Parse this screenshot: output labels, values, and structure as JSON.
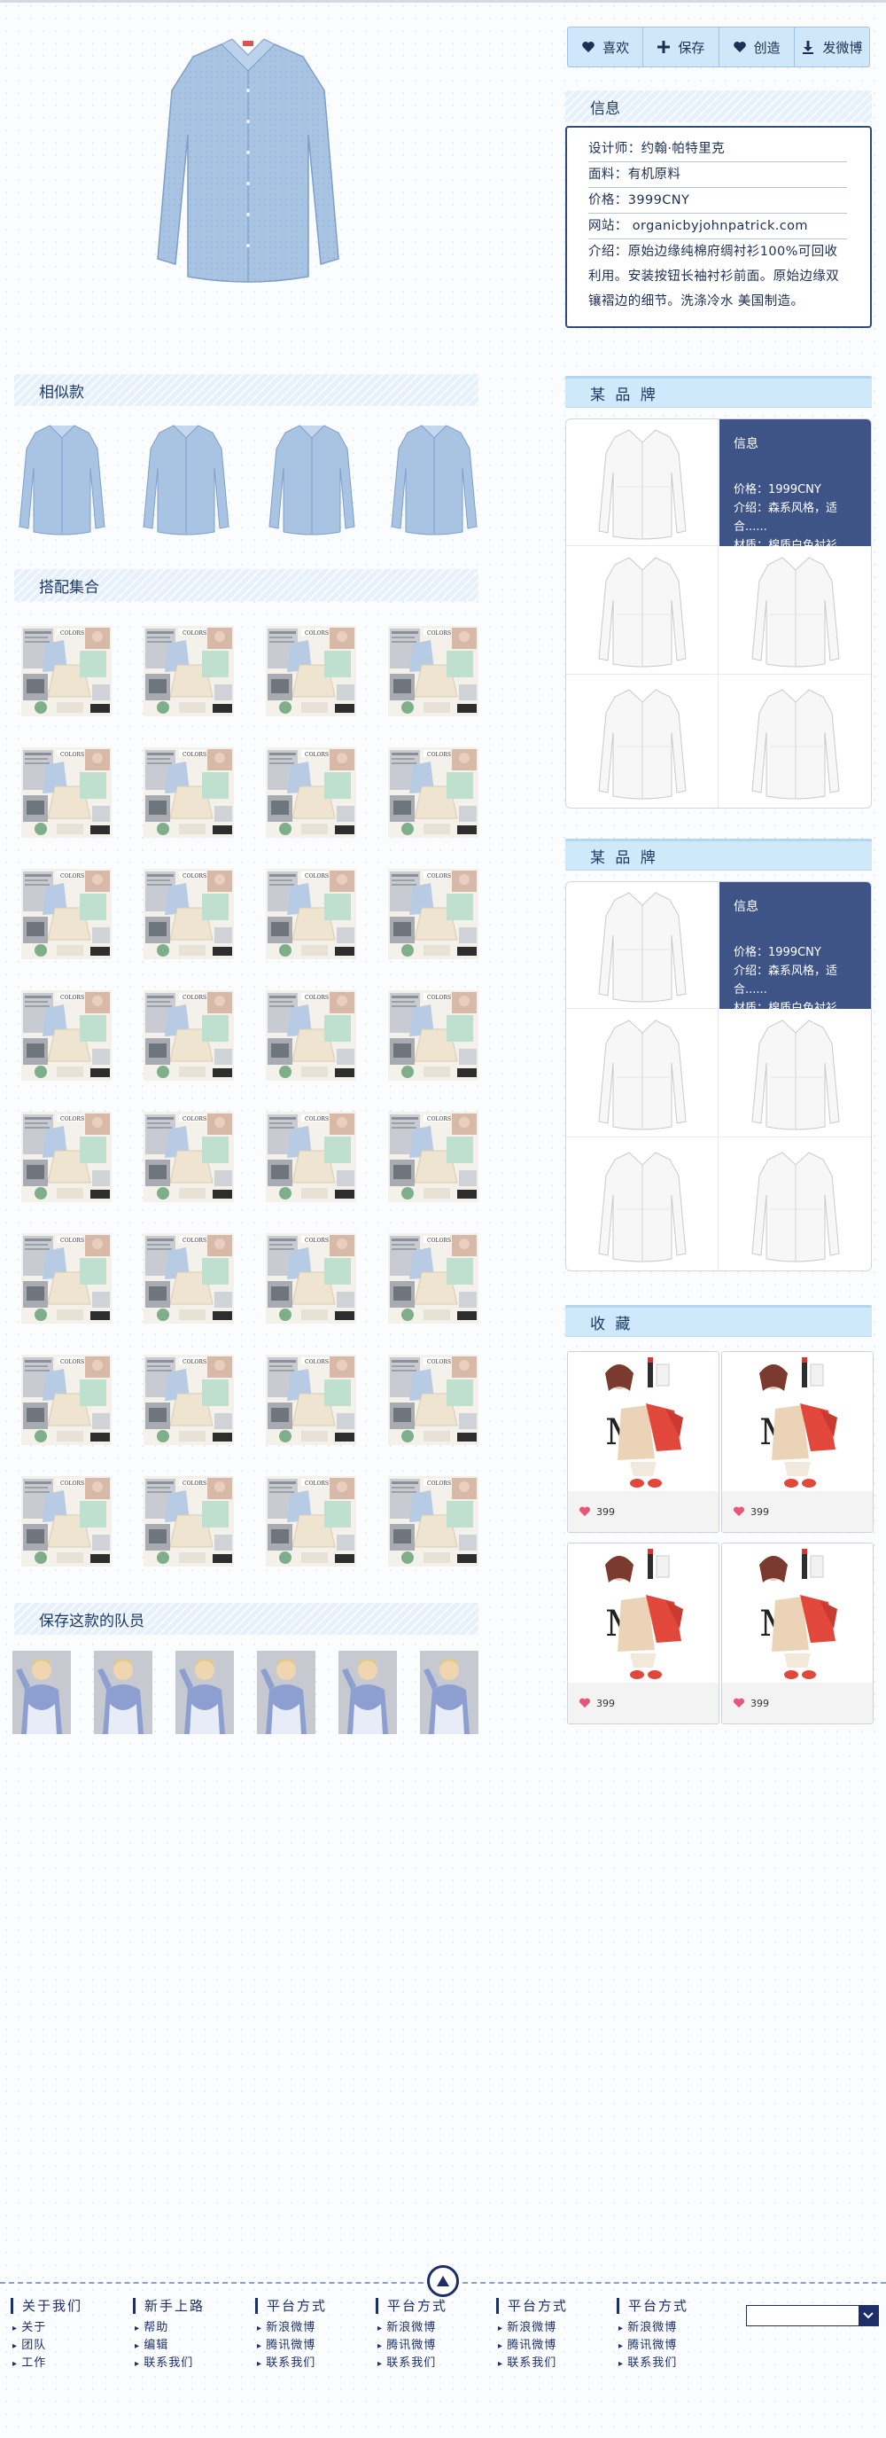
{
  "actions": [
    {
      "label": "喜欢",
      "icon": "heart-icon"
    },
    {
      "label": "保存",
      "icon": "plus-icon"
    },
    {
      "label": "创造",
      "icon": "heart-icon"
    },
    {
      "label": "发微博",
      "icon": "download-icon"
    }
  ],
  "info": {
    "title": "信息",
    "designer": "设计师：约翰·帕特里克",
    "fabric": "面料：有机原料",
    "price": "价格：3999CNY",
    "website": "网站： organicbyjohnpatrick.com",
    "desc_line1": "介绍：原始边缘纯棉府绸衬衫100%可回收",
    "desc_line2": "利用。安装按钮长袖衬衫前面。原始边缘双",
    "desc_line3": "镶褶边的细节。洗涤冷水 美国制造。"
  },
  "sections": {
    "similar": "相似款",
    "outfits": "搭配集合",
    "team": "保存这款的队员"
  },
  "brand_panels": [
    {
      "title": "某 品 牌",
      "overlay": {
        "title": "信息",
        "price": "价格：1999CNY",
        "intro": "介绍：森系风格，适合......",
        "material": "材质：棉质白色衬衫"
      }
    },
    {
      "title": "某 品 牌",
      "overlay": {
        "title": "信息",
        "price": "价格：1999CNY",
        "intro": "介绍：森系风格，适合......",
        "material": "材质：棉质白色衬衫"
      }
    }
  ],
  "favorites": {
    "title": "收 藏",
    "items": [
      {
        "count": "399"
      },
      {
        "count": "399"
      },
      {
        "count": "399"
      },
      {
        "count": "399"
      }
    ]
  },
  "footer": {
    "columns": [
      {
        "title": "关于我们",
        "links": [
          "关于",
          "团队",
          "工作"
        ]
      },
      {
        "title": "新手上路",
        "links": [
          "帮助",
          "编辑",
          "联系我们"
        ]
      },
      {
        "title": "平台方式",
        "links": [
          "新浪微博",
          "腾讯微博",
          "联系我们"
        ]
      },
      {
        "title": "平台方式",
        "links": [
          "新浪微博",
          "腾讯微博",
          "联系我们"
        ]
      },
      {
        "title": "平台方式",
        "links": [
          "新浪微博",
          "腾讯微博",
          "联系我们"
        ]
      },
      {
        "title": "平台方式",
        "links": [
          "新浪微博",
          "腾讯微博",
          "联系我们"
        ]
      }
    ],
    "select_value": ""
  },
  "colors": {
    "navy": "#1d2f66",
    "overlay": "#3e5487",
    "header_bg": "#cfe9fb",
    "heart": "#e8577a"
  }
}
